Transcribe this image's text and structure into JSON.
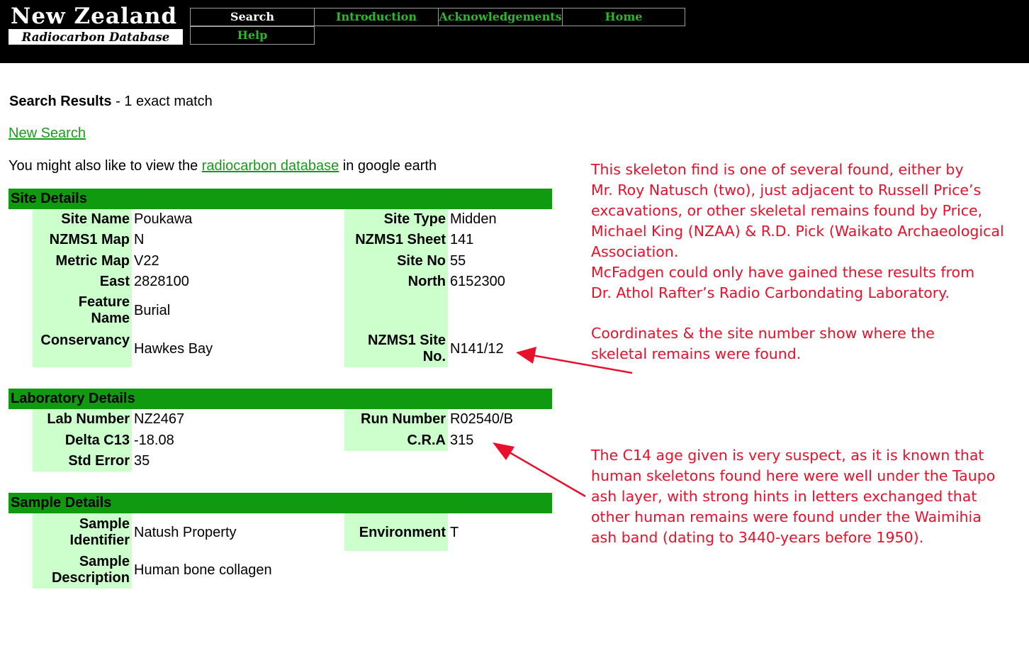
{
  "header": {
    "logo_title": "New Zealand",
    "logo_subtitle": "Radiocarbon Database",
    "nav": {
      "search": "Search",
      "introduction": "Introduction",
      "acknowledgements": "Acknowledgements",
      "home": "Home",
      "help": "Help"
    }
  },
  "results": {
    "label": "Search Results",
    "count_text": " - 1 exact match",
    "new_search": "New Search",
    "also_prefix": "You might also like to view the ",
    "also_link": "radiocarbon database",
    "also_suffix": " in google earth"
  },
  "site_details": {
    "title": "Site Details",
    "site_name_label": "Site Name",
    "site_name": "Poukawa",
    "site_type_label": "Site Type",
    "site_type": "Midden",
    "map_label": "NZMS1 Map",
    "map": "N",
    "sheet_label": "NZMS1 Sheet",
    "sheet": "141",
    "metric_map_label": "Metric Map",
    "metric_map": "V22",
    "site_no_label": "Site No",
    "site_no": "55",
    "east_label": "East",
    "east": "2828100",
    "north_label": "North",
    "north": "6152300",
    "feature_label_1": "Feature",
    "feature_label_2": "Name",
    "feature": "Burial",
    "conservancy_label": "Conservancy",
    "conservancy": "Hawkes Bay",
    "nzms1_site_label_1": "NZMS1 Site",
    "nzms1_site_label_2": "No.",
    "nzms1_site": "N141/12"
  },
  "lab_details": {
    "title": "Laboratory Details",
    "lab_number_label": "Lab Number",
    "lab_number": "NZ2467",
    "run_number_label": "Run Number",
    "run_number": "R02540/B",
    "delta_label": "Delta C13",
    "delta": "-18.08",
    "cra_label": "C.R.A",
    "cra": "315",
    "std_error_label": "Std Error",
    "std_error": "35"
  },
  "sample_details": {
    "title": "Sample Details",
    "identifier_label_1": "Sample",
    "identifier_label_2": "Identifier",
    "identifier": "Natush Property",
    "environment_label": "Environment",
    "environment": "T",
    "description_label_1": "Sample",
    "description_label_2": "Description",
    "description": "Human bone collagen"
  },
  "annotations": {
    "note1": [
      "This skeleton find is one of several found, either by",
      "Mr. Roy Natusch (two), just adjacent to Russell Price’s",
      "excavations, or other skeletal remains found by Price,",
      "Michael King (NZAA) & R.D. Pick (Waikato Archaeological",
      "Association.",
      "McFadgen could only have gained these results from",
      "Dr. Athol Rafter’s Radio Carbondating Laboratory."
    ],
    "note2": [
      "Coordinates & the site number show where the",
      "skeletal remains were found."
    ],
    "note3": [
      "The C14 age given is very suspect, as it is known that",
      "human skeletons found here were well under the Taupo",
      "ash layer, with strong hints in letters exchanged that",
      "other human remains were found under the Waimihia",
      "ash band (dating to 3440-years before 1950)."
    ]
  },
  "colors": {
    "section_bar": "#0f9a0f",
    "label_cell": "#ccffcc",
    "link": "#1a9a1a",
    "annotation": "#e8102a",
    "header_bg": "#000000"
  }
}
